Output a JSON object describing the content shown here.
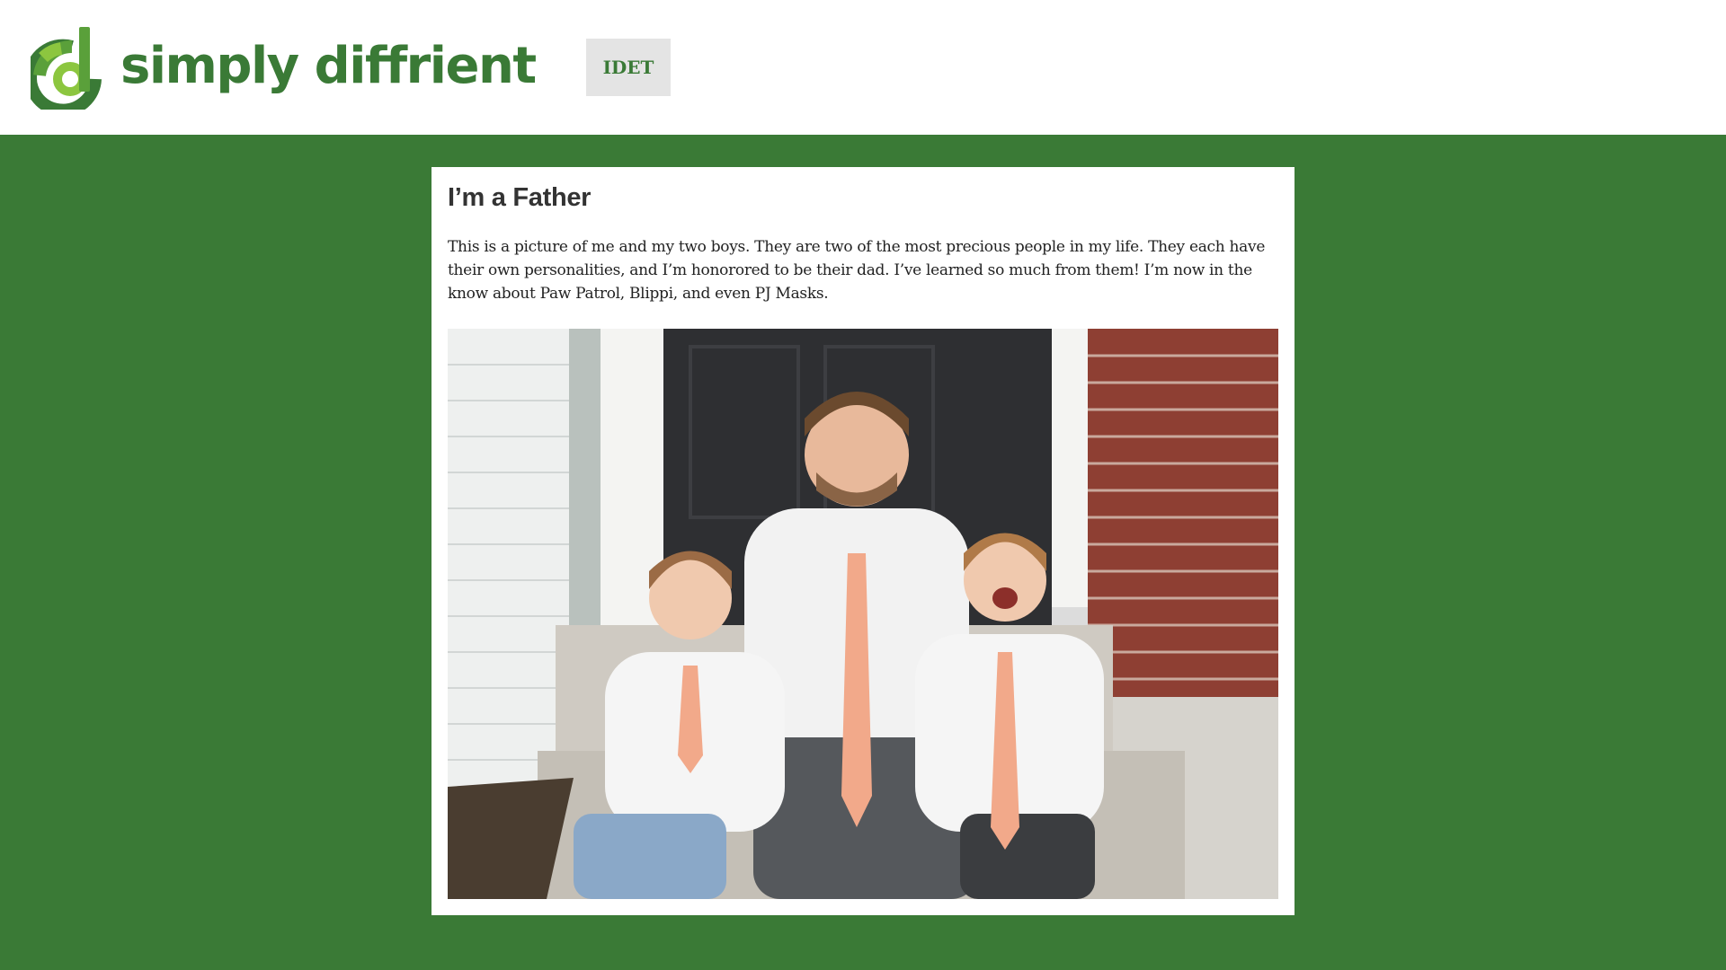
{
  "brand": {
    "name": "simply diffrient",
    "colors": {
      "primary": "#3a7a36",
      "light": "#8cc63f",
      "mid": "#5aa03a"
    }
  },
  "nav": {
    "button_label": "IDET"
  },
  "post": {
    "title": "I’m a Father",
    "body": "This is a picture of me and my two boys. They are two of the most precious people in my life. They each have their own personalities, and I’m honorored to be their dad. I’ve learned so much from them! I’m now in the know about Paw Patrol, Blippi, and even PJ Masks."
  },
  "colors": {
    "page_background": "#3a7a36",
    "header_background": "#ffffff",
    "card_background": "#ffffff",
    "button_background": "#e4e4e4"
  }
}
